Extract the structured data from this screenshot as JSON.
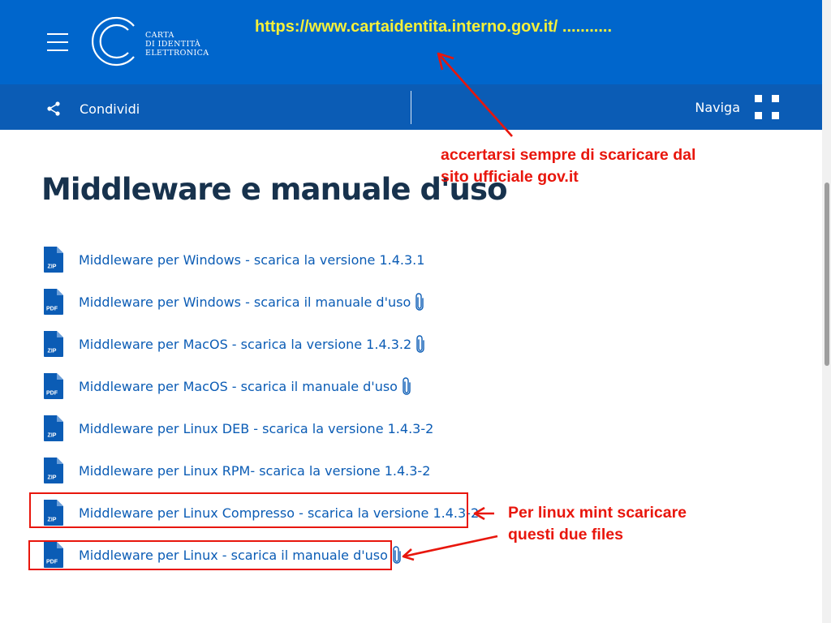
{
  "header": {
    "logo_lines": [
      "CARTA",
      "DI IDENTITÀ",
      "ELETTRONICA"
    ],
    "url_annotation": "https://www.cartaidentita.interno.gov.it/ ..........."
  },
  "subnav": {
    "share_label": "Condividi",
    "navigate_label": "Naviga"
  },
  "main": {
    "title": "Middleware e manuale d'uso",
    "files": [
      {
        "type": "ZIP",
        "label": "Middleware per Windows - scarica la versione 1.4.3.1",
        "attachment": false
      },
      {
        "type": "PDF",
        "label": "Middleware per Windows - scarica il manuale d'uso",
        "attachment": true
      },
      {
        "type": "ZIP",
        "label": "Middleware per MacOS - scarica la versione 1.4.3.2",
        "attachment": true
      },
      {
        "type": "PDF",
        "label": "Middleware per MacOS - scarica il manuale d'uso",
        "attachment": true
      },
      {
        "type": "ZIP",
        "label": "Middleware per Linux DEB - scarica la versione 1.4.3-2",
        "attachment": false
      },
      {
        "type": "ZIP",
        "label": "Middleware per Linux RPM- scarica la versione 1.4.3-2",
        "attachment": false
      },
      {
        "type": "ZIP",
        "label": "Middleware per Linux Compresso - scarica la versione 1.4.3-2",
        "attachment": false
      },
      {
        "type": "PDF",
        "label": "Middleware per Linux - scarica il manuale d'uso",
        "attachment": true
      }
    ]
  },
  "annotations": {
    "official_site_note": [
      "accertarsi sempre di scaricare dal",
      "sito ufficiale gov.it"
    ],
    "linux_mint_note": [
      "Per linux mint scaricare",
      "questi due files"
    ]
  },
  "colors": {
    "header_blue": "#0066cc",
    "subbar_blue": "#0b5cb5",
    "link_blue": "#0b5cb5",
    "title_dark": "#17324d",
    "annotation_red": "#e8160c",
    "annotation_yellow": "#f5f03a"
  }
}
